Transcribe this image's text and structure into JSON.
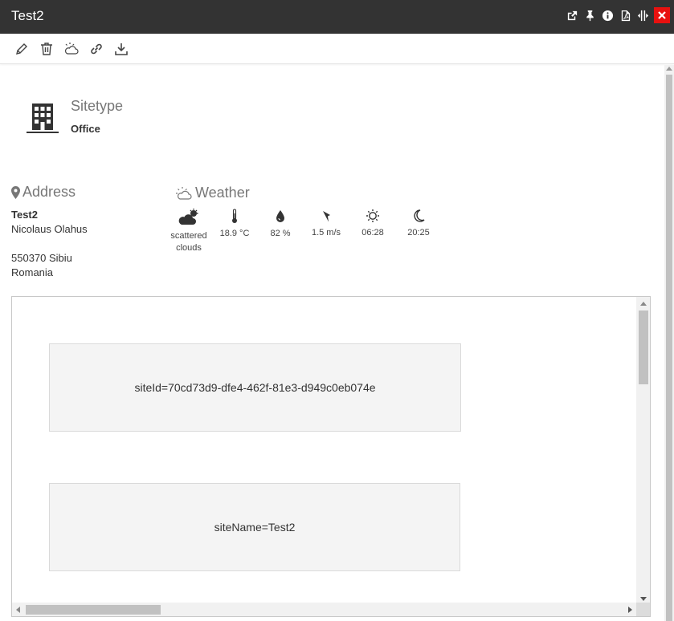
{
  "window": {
    "title": "Test2",
    "title_icons": [
      "popout-icon",
      "pin-icon",
      "info-icon",
      "pdf-icon",
      "resize-icon",
      "close-icon"
    ]
  },
  "toolbar": {
    "tools": [
      "edit-icon",
      "delete-icon",
      "weather-icon",
      "link-icon",
      "download-icon"
    ]
  },
  "sitetype": {
    "label": "Sitetype",
    "value": "Office"
  },
  "address": {
    "label": "Address",
    "name": "Test2",
    "street": "Nicolaus Olahus",
    "city": "550370 Sibiu",
    "country": "Romania"
  },
  "weather": {
    "label": "Weather",
    "condition_line1": "scattered",
    "condition_line2": "clouds",
    "temperature": "18.9 °C",
    "humidity": "82 %",
    "wind": "1.5 m/s",
    "sunrise": "06:28",
    "sunset": "20:25"
  },
  "frame": {
    "card1": "siteId=70cd73d9-dfe4-462f-81e3-d949c0eb074e",
    "card2": "siteName=Test2"
  },
  "colors": {
    "titlebar": "#333333",
    "close": "#e8110f",
    "card_bg": "#f4f4f4"
  }
}
